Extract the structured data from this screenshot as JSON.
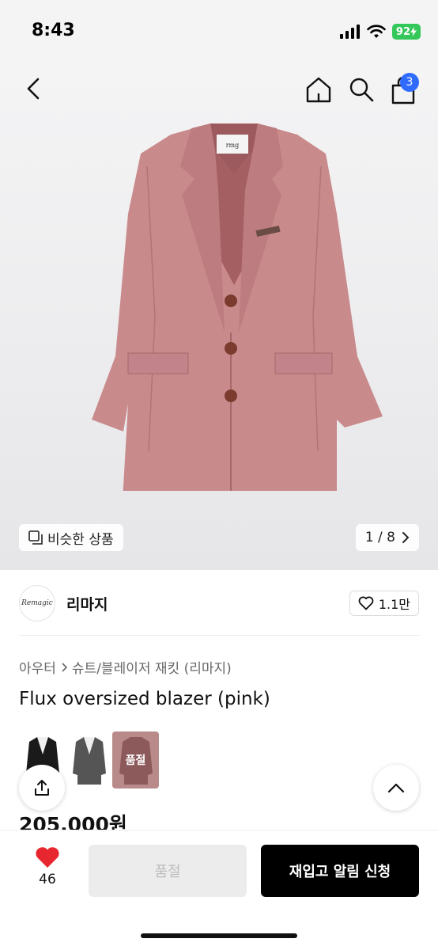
{
  "status_bar": {
    "time": "8:43",
    "battery": "92"
  },
  "nav": {
    "cart_count": "3"
  },
  "hero": {
    "similar_label": "비슷한 상품",
    "pager": "1 / 8"
  },
  "brand": {
    "logo_text": "Remagic",
    "name": "리마지",
    "likes": "1.1만"
  },
  "breadcrumb": {
    "category": "아우터",
    "subcategory": "슈트/블레이저 재킷 (리마지)"
  },
  "product": {
    "title": "Flux oversized blazer (pink)",
    "price": "205,000원",
    "sold_out_badge": "품절"
  },
  "colors": {
    "jacket_pink": "#c98a8c",
    "black": "#000000",
    "restock_blue": "#2f6bff",
    "heart_red": "#e8262f"
  },
  "bottom_bar": {
    "wishlist_count": "46",
    "sold_out_label": "품절",
    "restock_label": "재입고 알림 신청"
  }
}
